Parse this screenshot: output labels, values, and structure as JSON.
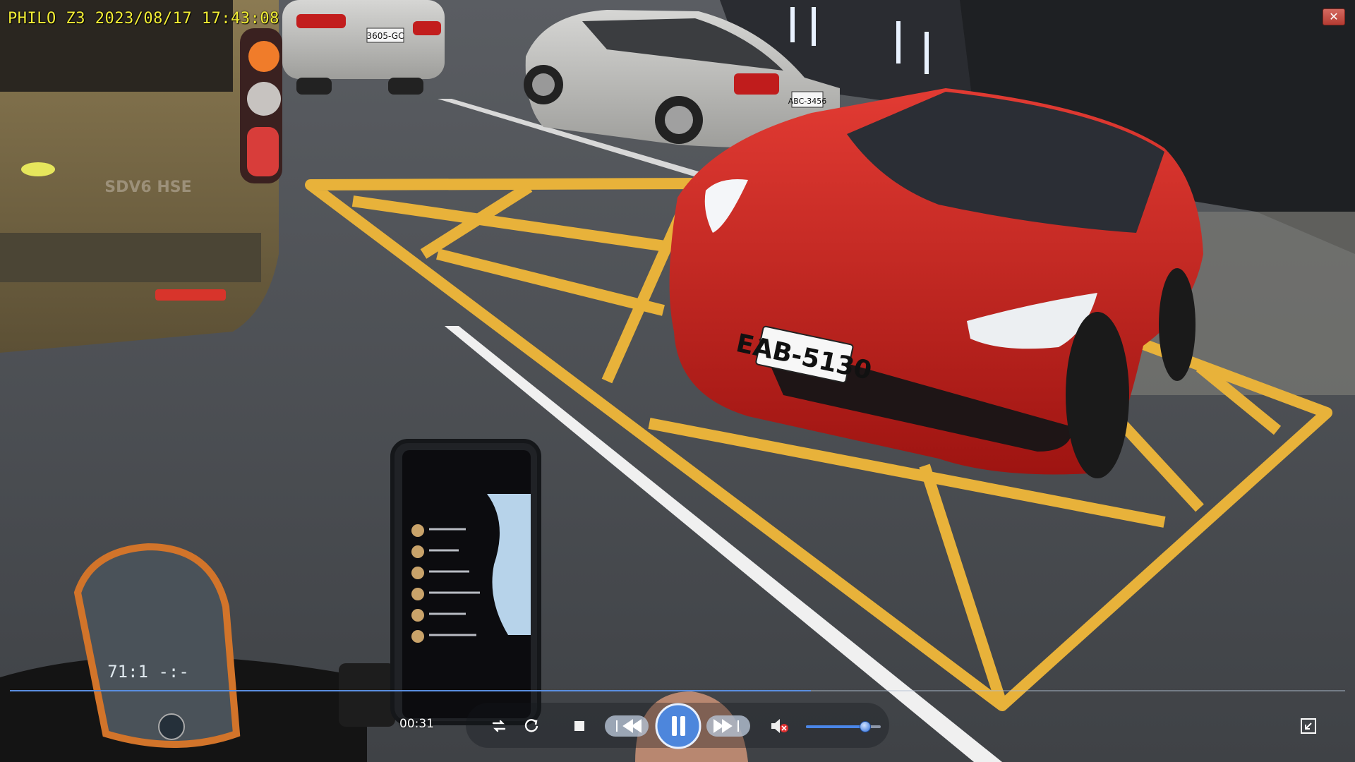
{
  "window": {
    "osd_text": "PHILO Z3 2023/08/17 17:43:08",
    "close_symbol": "✕"
  },
  "scene": {
    "plate_front": "EAB-5130",
    "plate_silver_left": "3605-GC",
    "plate_silver_right": "ABC-3456",
    "van_badge": "SDV6 HSE"
  },
  "player": {
    "elapsed": "00:31",
    "seek_progress": 0.6,
    "volume_level": 0.78,
    "accent_color": "#4a86e8",
    "icons": [
      "repeat-icon",
      "refresh-icon",
      "stop-icon",
      "previous-icon",
      "pause-icon",
      "next-icon",
      "mute-icon",
      "fullscreen-icon"
    ]
  },
  "colors": {
    "osd": "#f3ee35",
    "road_marking": "#e8b23a",
    "tesla_red": "#c81c1a"
  }
}
